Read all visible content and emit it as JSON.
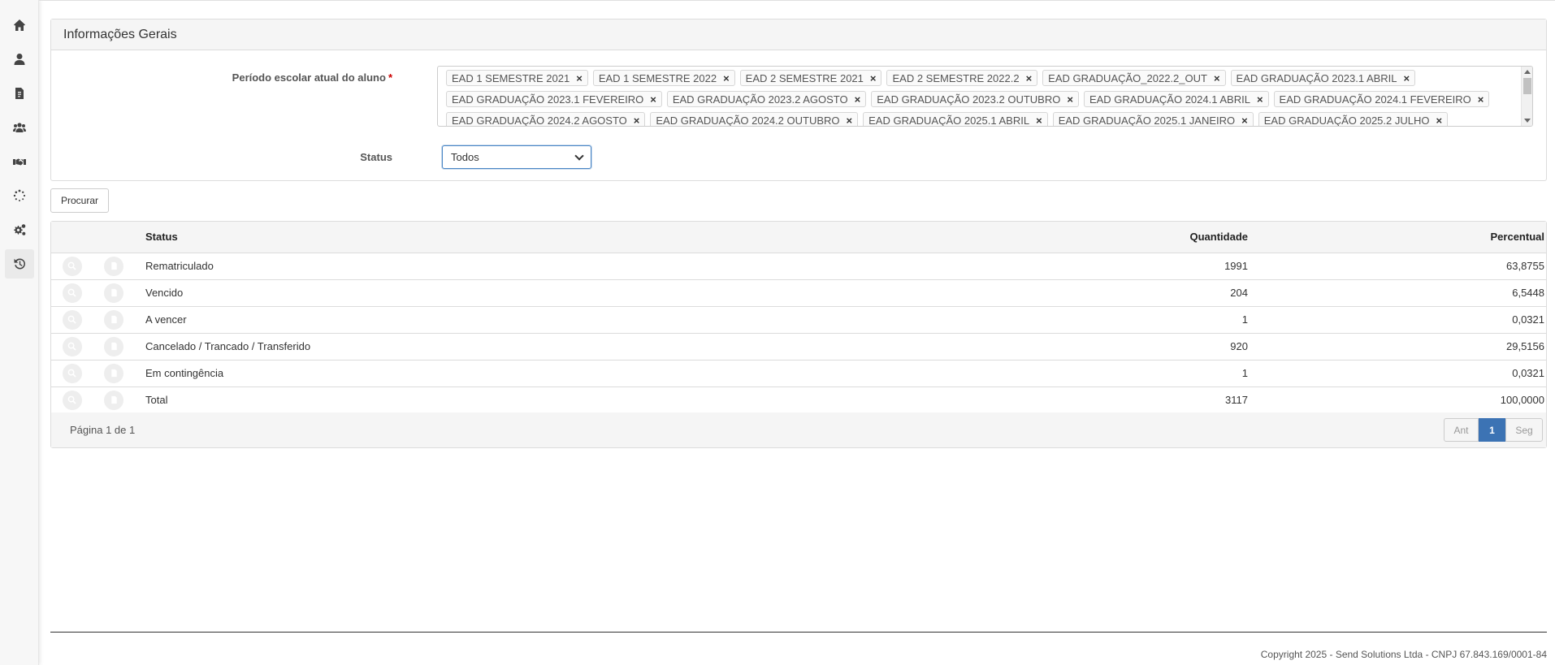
{
  "sidebar": {
    "items": [
      {
        "icon": "home-icon",
        "active": false
      },
      {
        "icon": "user-icon",
        "active": false
      },
      {
        "icon": "document-icon",
        "active": false
      },
      {
        "icon": "users-icon",
        "active": false
      },
      {
        "icon": "handshake-icon",
        "active": false
      },
      {
        "icon": "spinner-icon",
        "active": false
      },
      {
        "icon": "gears-icon",
        "active": false
      },
      {
        "icon": "history-icon",
        "active": true
      }
    ]
  },
  "panel": {
    "title": "Informações Gerais",
    "periodo_label": "Período escolar atual do aluno",
    "required_mark": "*",
    "status_label": "Status",
    "status_value": "Todos",
    "tag_rows": [
      [
        "EAD 1 SEMESTRE 2021",
        "EAD 1 SEMESTRE 2022",
        "EAD 2 SEMESTRE 2021",
        "EAD 2 SEMESTRE 2022.2",
        "EAD GRADUAÇÃO_2022.2_OUT",
        "EAD GRADUAÇÃO 2023.1 ABRIL"
      ],
      [
        "EAD GRADUAÇÃO 2023.1 FEVEREIRO",
        "EAD GRADUAÇÃO 2023.2 AGOSTO",
        "EAD GRADUAÇÃO 2023.2 OUTUBRO",
        "EAD GRADUAÇÃO 2024.1 ABRIL",
        "EAD GRADUAÇÃO 2024.1 FEVEREIRO"
      ],
      [
        "EAD GRADUAÇÃO 2024.2 AGOSTO",
        "EAD GRADUAÇÃO 2024.2 OUTUBRO",
        "EAD GRADUAÇÃO 2025.1 ABRIL",
        "EAD GRADUAÇÃO 2025.1 JANEIRO",
        "EAD GRADUAÇÃO 2025.2 JULHO"
      ]
    ],
    "tag_remove": "×"
  },
  "search_button": "Procurar",
  "table": {
    "headers": {
      "status": "Status",
      "quantidade": "Quantidade",
      "percentual": "Percentual"
    },
    "rows": [
      {
        "status": "Rematriculado",
        "quantidade": "1991",
        "percentual": "63,8755"
      },
      {
        "status": "Vencido",
        "quantidade": "204",
        "percentual": "6,5448"
      },
      {
        "status": "A vencer",
        "quantidade": "1",
        "percentual": "0,0321"
      },
      {
        "status": "Cancelado / Trancado / Transferido",
        "quantidade": "920",
        "percentual": "29,5156"
      },
      {
        "status": "Em contingência",
        "quantidade": "1",
        "percentual": "0,0321"
      },
      {
        "status": "Total",
        "quantidade": "3117",
        "percentual": "100,0000"
      }
    ]
  },
  "pagination": {
    "info": "Página 1 de 1",
    "prev": "Ant",
    "current": "1",
    "next": "Seg"
  },
  "footer": {
    "copyright": "Copyright 2025 - Send Solutions Ltda - CNPJ 67.843.169/0001-84"
  }
}
